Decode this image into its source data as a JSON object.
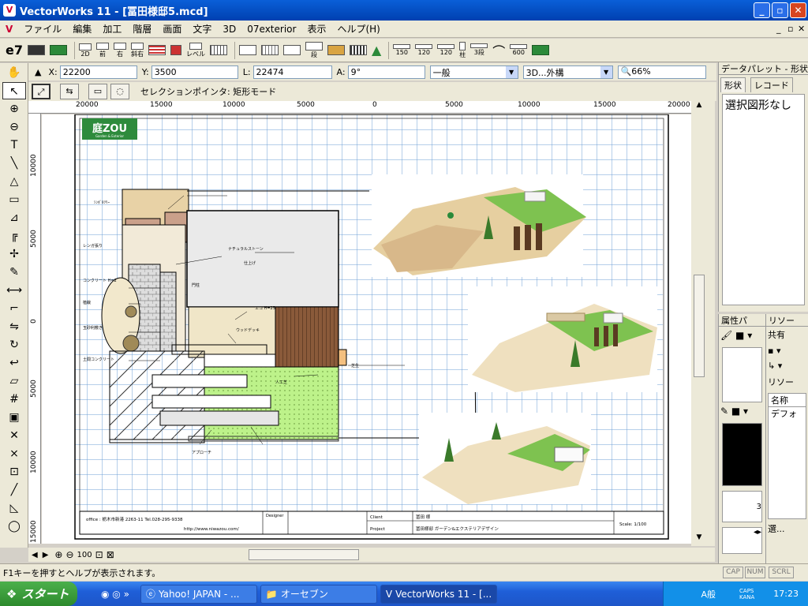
{
  "window": {
    "title": "VectorWorks 11 - [冨田様邸5.mcd]",
    "min_label": "_",
    "max_label": "▫",
    "close_label": "✕"
  },
  "menu": [
    "ファイル",
    "編集",
    "加工",
    "階層",
    "画面",
    "文字",
    "3D",
    "07exterior",
    "表示",
    "ヘルプ(H)"
  ],
  "toolbar": {
    "items": [
      {
        "icon": "view-2d-icon",
        "label": "2D"
      },
      {
        "icon": "view-front-icon",
        "label": "前"
      },
      {
        "icon": "view-right-icon",
        "label": "右"
      },
      {
        "icon": "view-iso-icon",
        "label": "斜右"
      },
      {
        "icon": "hatch-icon",
        "label": ""
      },
      {
        "icon": "symbol-icon",
        "label": ""
      },
      {
        "icon": "level-icon",
        "label": "レベル"
      },
      {
        "icon": "fence-icon",
        "label": ""
      },
      {
        "icon": "frame-icon",
        "label": ""
      },
      {
        "icon": "grid-icon",
        "label": ""
      },
      {
        "icon": "stair-icon",
        "label": ""
      },
      {
        "icon": "step-icon",
        "label": "段"
      },
      {
        "icon": "wall-icon",
        "label": ""
      },
      {
        "icon": "pillar-icon",
        "label": ""
      },
      {
        "icon": "tree-icon",
        "label": ""
      },
      {
        "icon": "block-150-icon",
        "label": "150"
      },
      {
        "icon": "block-120-icon",
        "label": "120"
      },
      {
        "icon": "block-120b-icon",
        "label": "120"
      },
      {
        "icon": "post-icon",
        "label": "柱"
      },
      {
        "icon": "tile-icon",
        "label": "3段"
      },
      {
        "icon": "arc-icon",
        "label": ""
      },
      {
        "icon": "scale-600-icon",
        "label": "600"
      },
      {
        "icon": "plant-icon",
        "label": ""
      }
    ]
  },
  "databar": {
    "x_label": "X:",
    "x_value": "22200",
    "y_label": "Y:",
    "y_value": "3500",
    "l_label": "L:",
    "l_value": "22474",
    "a_label": "A:",
    "a_value": "9°",
    "class_value": "一般",
    "layer_value": "3D...外構",
    "zoom_value": "66%"
  },
  "modebar": {
    "mode_text": "セレクションポインタ: 矩形モード"
  },
  "ruler": {
    "h_ticks": [
      "20000",
      "15000",
      "10000",
      "5000",
      "0",
      "5000",
      "10000",
      "15000",
      "20000"
    ],
    "v_ticks": [
      "10000",
      "5000",
      "0",
      "5000",
      "10000",
      "15000"
    ]
  },
  "drawing": {
    "logo_text": "庭ZOU",
    "logo_sub": "Garden & Exterior",
    "labels": {
      "lbl_a": "ｼﾝﾎﾞﾙﾂﾘｰ",
      "lbl_b": "レンガ張り",
      "lbl_c": "コンクリート H=2",
      "lbl_d": "ナチュラルストーン",
      "lbl_e": "仕上げ",
      "lbl_f": "エコ H=25",
      "lbl_g": "ウッドデッキ",
      "lbl_h": "人工芝",
      "lbl_i": "植栽",
      "lbl_j": "玉砂利敷き",
      "lbl_k": "土間コンクリート",
      "lbl_l": "芝生",
      "lbl_m": "門柱",
      "lbl_n": "アプローチ"
    },
    "title_block": {
      "office": "office : 栃木市新港 2263-11  Tel.028-295-9338",
      "url": "http://www.niwazou.com/",
      "designer_label": "Designer",
      "client_label": "Client",
      "client_value": "冨田 様",
      "project_label": "Project",
      "project_value": "冨田様邸 ガーデン&エクステリアデザイン",
      "scale": "Scale: 1/100"
    }
  },
  "bottom_nav": {
    "zoom_value": "100"
  },
  "status": {
    "text": "F1キーを押すとヘルプが表示されます。",
    "cap": "CAP",
    "num": "NUM",
    "scrl": "SCRL"
  },
  "palette_data": {
    "title": "データパレット - 形状",
    "tab_shape": "形状",
    "tab_record": "レコード",
    "no_selection": "選択図形なし"
  },
  "palette_attr": {
    "title": "属性パ",
    "value": "3"
  },
  "palette_res": {
    "title": "リソー",
    "shared_label": "共有",
    "dropdown_label": "リソー",
    "col_name": "名称",
    "item": "デフォ",
    "footer": "選..."
  },
  "taskbar": {
    "start": "スタート",
    "tasks": [
      "Yahoo! JAPAN - ...",
      "オーセブン",
      "VectorWorks 11 - [..."
    ],
    "ime_mode": "A般",
    "caps": "CAPS",
    "kana": "KANA",
    "clock": "17:23"
  }
}
